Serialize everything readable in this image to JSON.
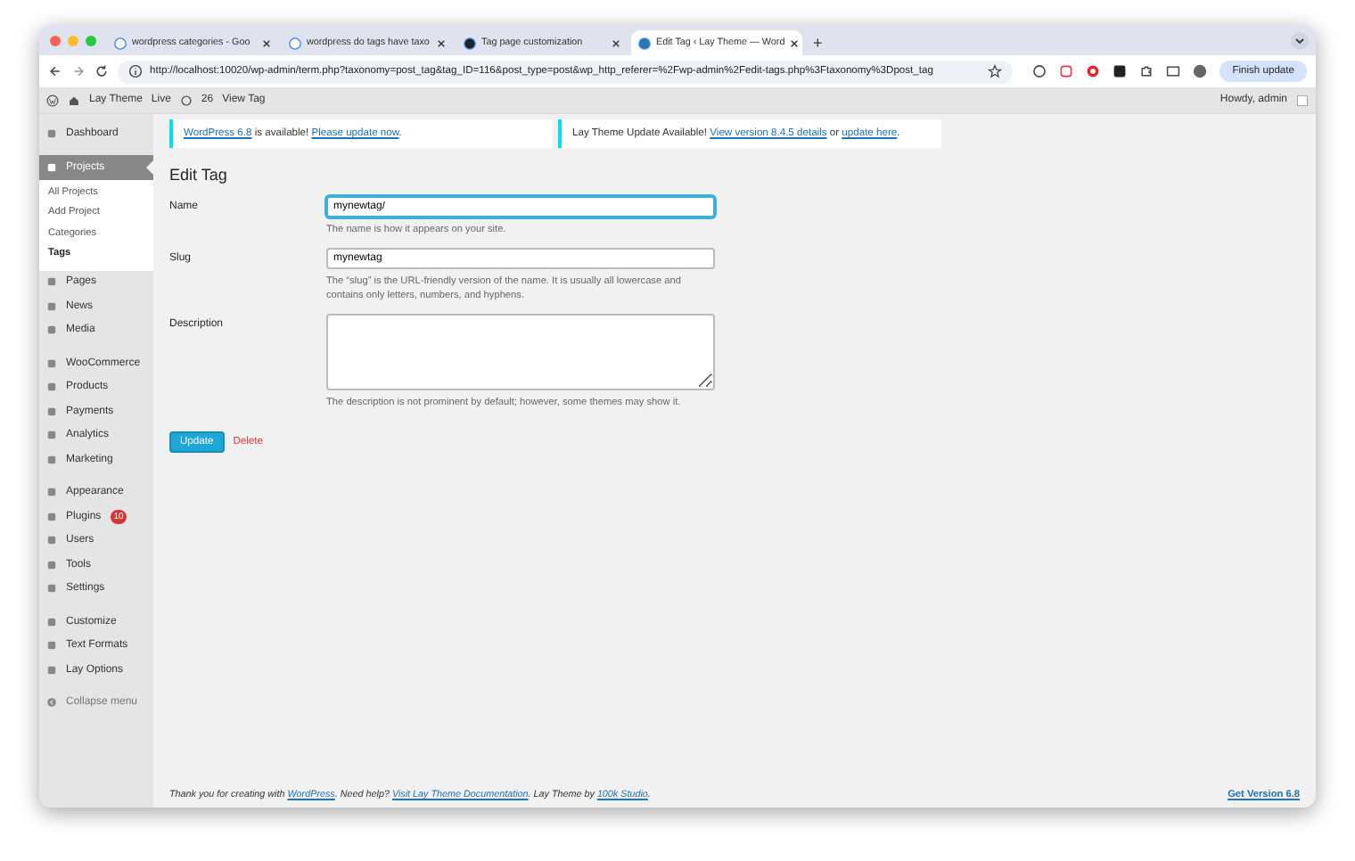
{
  "browser": {
    "tabs": [
      {
        "title": "wordpress categories - Goo",
        "selected": false
      },
      {
        "title": "wordpress do tags have taxo",
        "selected": false
      },
      {
        "title": "Tag page customization",
        "selected": false
      },
      {
        "title": "Edit Tag ‹ Lay Theme — Word",
        "selected": true
      }
    ],
    "new_tab": "+",
    "url": "http://localhost:10020/wp-admin/term.php?taxonomy=post_tag&tag_ID=116&post_type=post&wp_http_referer=%2Fwp-admin%2Fedit-tags.php%3Ftaxonomy%3Dpost_tag",
    "finish_update": "Finish update"
  },
  "admin_bar": {
    "site": "Lay Theme",
    "live": "Live",
    "comments": "26",
    "view": "View Tag",
    "greeting": "Howdy, admin"
  },
  "sidebar": {
    "groups": [
      [
        {
          "label": "Dashboard",
          "selected": false
        }
      ],
      [
        {
          "label": "Projects",
          "selected": true,
          "submenu": [
            {
              "label": "All Projects",
              "selected": false
            },
            {
              "label": "Add Project",
              "selected": false
            },
            {
              "label": "Categories",
              "selected": false
            },
            {
              "label": "Tags",
              "selected": true
            }
          ]
        },
        {
          "label": "Pages",
          "selected": false
        },
        {
          "label": "News",
          "selected": false
        },
        {
          "label": "Media",
          "selected": false
        }
      ],
      [
        {
          "label": "WooCommerce",
          "selected": false
        },
        {
          "label": "Products",
          "selected": false
        },
        {
          "label": "Payments",
          "selected": false
        },
        {
          "label": "Analytics",
          "selected": false
        },
        {
          "label": "Marketing",
          "selected": false
        }
      ],
      [
        {
          "label": "Appearance",
          "selected": false
        },
        {
          "label": "Plugins",
          "selected": false,
          "badge": "10"
        },
        {
          "label": "Users",
          "selected": false
        },
        {
          "label": "Tools",
          "selected": false
        },
        {
          "label": "Settings",
          "selected": false
        }
      ],
      [
        {
          "label": "Customize",
          "selected": false
        },
        {
          "label": "Text Formats",
          "selected": false
        },
        {
          "label": "Lay Options",
          "selected": false
        }
      ]
    ],
    "collapse": "Collapse menu"
  },
  "notices": [
    [
      {
        "text": "WordPress 6.8",
        "link": true
      },
      {
        "text": " is available! ",
        "link": false
      },
      {
        "text": "Please update now",
        "link": true
      },
      {
        "text": ".",
        "link": false
      }
    ],
    [
      {
        "text": "Lay Theme Update Available! ",
        "link": false
      },
      {
        "text": "View version 8.4.5 details",
        "link": true
      },
      {
        "text": " or ",
        "link": false
      },
      {
        "text": "update here",
        "link": true
      },
      {
        "text": ".",
        "link": false
      }
    ]
  ],
  "form": {
    "title": "Edit Tag",
    "fields": [
      {
        "kind": "input",
        "label": "Name",
        "value": "mynewtag/",
        "focused": true,
        "help": "The name is how it appears on your site."
      },
      {
        "kind": "input",
        "label": "Slug",
        "value": "mynewtag",
        "focused": false,
        "help": "The “slug” is the URL-friendly version of the name. It is usually all lowercase and contains only letters, numbers, and hyphens."
      },
      {
        "kind": "textarea",
        "label": "Description",
        "focused": false,
        "help": "The description is not prominent by default; however, some themes may show it."
      }
    ],
    "update": "Update",
    "delete": "Delete"
  },
  "footer": {
    "credit": [
      {
        "text": "Thank you for creating with ",
        "link": false
      },
      {
        "text": "WordPress",
        "link": true
      },
      {
        "text": ". Need help? ",
        "link": false
      },
      {
        "text": "Visit Lay Theme Documentation",
        "link": true
      },
      {
        "text": ". Lay Theme by ",
        "link": false
      },
      {
        "text": "100k Studio",
        "link": true
      },
      {
        "text": ".",
        "link": false
      }
    ],
    "version": "Get Version 6.8"
  }
}
